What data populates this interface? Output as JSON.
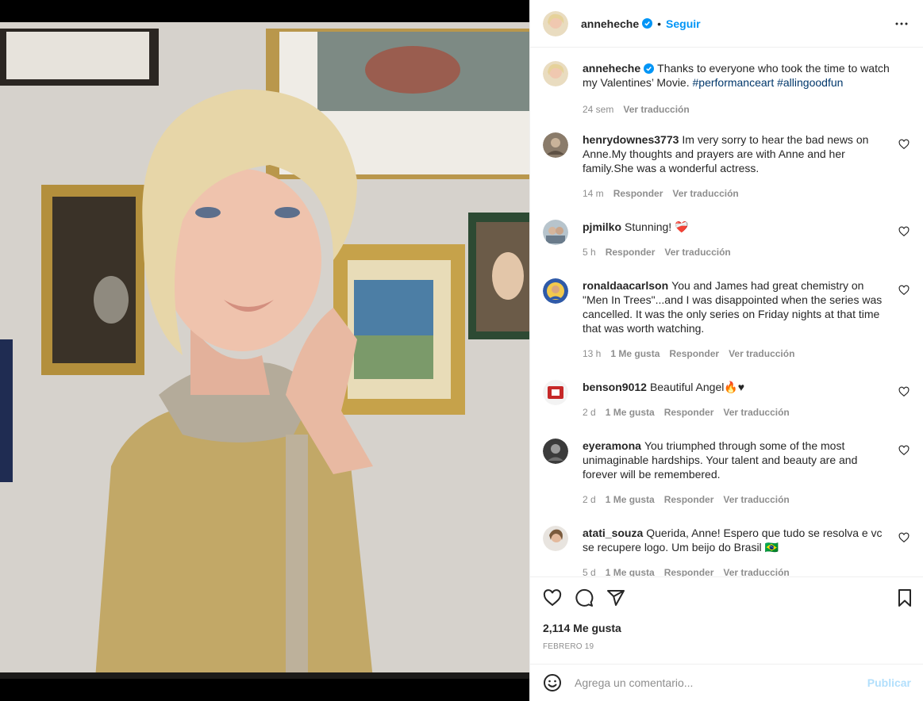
{
  "post": {
    "author": "anneheche",
    "follow_label": "Seguir",
    "separator": "•",
    "photo_alt_icon": "portrait-photo",
    "caption": {
      "username": "anneheche",
      "text": "Thanks to everyone who took the time to watch my Valentines’ Movie.",
      "hashtags": [
        "#performanceart",
        "#allingoodfun"
      ],
      "time": "24 sem",
      "translate": "Ver traducción"
    },
    "comments": [
      {
        "username": "henrydownes3773",
        "text": "Im very sorry to hear the bad news on Anne.My thoughts and prayers are with Anne and her family.She was a wonderful actress.",
        "time": "14 m",
        "likes": "",
        "reply": "Responder",
        "translate": "Ver traducción"
      },
      {
        "username": "pjmilko",
        "text": "Stunning! ❤️‍🩹",
        "time": "5 h",
        "likes": "",
        "reply": "Responder",
        "translate": "Ver traducción"
      },
      {
        "username": "ronaldaacarlson",
        "text": "You and James had great chemistry on \"Men In Trees\"...and I was disappointed when the series was cancelled. It was the only series on Friday nights at that time that was worth watching.",
        "time": "13 h",
        "likes": "1 Me gusta",
        "reply": "Responder",
        "translate": "Ver traducción"
      },
      {
        "username": "benson9012",
        "text": "Beautiful Angel🔥♥",
        "time": "2 d",
        "likes": "1 Me gusta",
        "reply": "Responder",
        "translate": "Ver traducción"
      },
      {
        "username": "eyeramona",
        "text": "You triumphed through some of the most unimaginable hardships. Your talent and beauty are and forever will be remembered.",
        "time": "2 d",
        "likes": "1 Me gusta",
        "reply": "Responder",
        "translate": "Ver traducción"
      },
      {
        "username": "atati_souza",
        "text": "Querida, Anne! Espero que tudo se resolva e vc se recupere logo. Um beijo do Brasil 🇧🇷",
        "time": "5 d",
        "likes": "1 Me gusta",
        "reply": "Responder",
        "translate": "Ver traducción"
      }
    ],
    "likes_count": "2,114 Me gusta",
    "date": "FEBRERO 19",
    "add_comment_placeholder": "Agrega un comentario...",
    "publish_label": "Publicar"
  },
  "colors": {
    "accent": "#0095f6",
    "hashtag": "#00376b",
    "muted": "#8e8e8e",
    "publish_disabled": "#b2dffc"
  },
  "icons": [
    "verified-badge-icon",
    "more-options-icon",
    "heart-icon",
    "comment-icon",
    "share-icon",
    "bookmark-icon",
    "emoji-icon"
  ]
}
